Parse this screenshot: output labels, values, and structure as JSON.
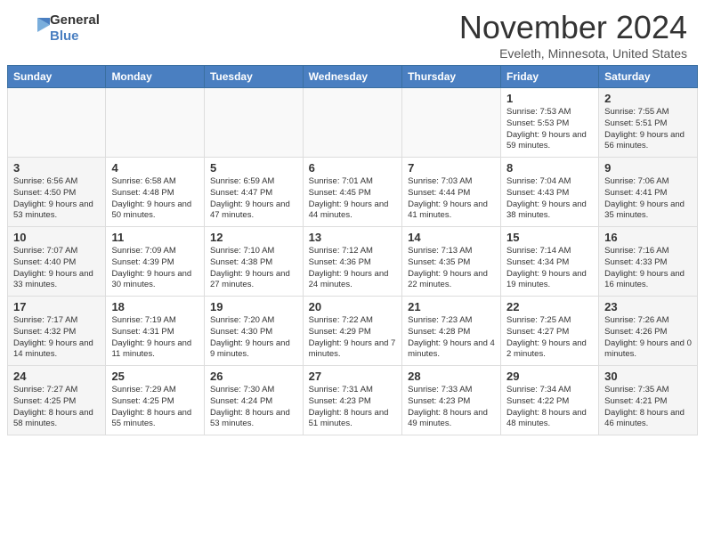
{
  "header": {
    "logo_general": "General",
    "logo_blue": "Blue",
    "month_title": "November 2024",
    "location": "Eveleth, Minnesota, United States"
  },
  "weekdays": [
    "Sunday",
    "Monday",
    "Tuesday",
    "Wednesday",
    "Thursday",
    "Friday",
    "Saturday"
  ],
  "weeks": [
    [
      {
        "day": "",
        "info": ""
      },
      {
        "day": "",
        "info": ""
      },
      {
        "day": "",
        "info": ""
      },
      {
        "day": "",
        "info": ""
      },
      {
        "day": "",
        "info": ""
      },
      {
        "day": "1",
        "info": "Sunrise: 7:53 AM\nSunset: 5:53 PM\nDaylight: 9 hours and 59 minutes."
      },
      {
        "day": "2",
        "info": "Sunrise: 7:55 AM\nSunset: 5:51 PM\nDaylight: 9 hours and 56 minutes."
      }
    ],
    [
      {
        "day": "3",
        "info": "Sunrise: 6:56 AM\nSunset: 4:50 PM\nDaylight: 9 hours and 53 minutes."
      },
      {
        "day": "4",
        "info": "Sunrise: 6:58 AM\nSunset: 4:48 PM\nDaylight: 9 hours and 50 minutes."
      },
      {
        "day": "5",
        "info": "Sunrise: 6:59 AM\nSunset: 4:47 PM\nDaylight: 9 hours and 47 minutes."
      },
      {
        "day": "6",
        "info": "Sunrise: 7:01 AM\nSunset: 4:45 PM\nDaylight: 9 hours and 44 minutes."
      },
      {
        "day": "7",
        "info": "Sunrise: 7:03 AM\nSunset: 4:44 PM\nDaylight: 9 hours and 41 minutes."
      },
      {
        "day": "8",
        "info": "Sunrise: 7:04 AM\nSunset: 4:43 PM\nDaylight: 9 hours and 38 minutes."
      },
      {
        "day": "9",
        "info": "Sunrise: 7:06 AM\nSunset: 4:41 PM\nDaylight: 9 hours and 35 minutes."
      }
    ],
    [
      {
        "day": "10",
        "info": "Sunrise: 7:07 AM\nSunset: 4:40 PM\nDaylight: 9 hours and 33 minutes."
      },
      {
        "day": "11",
        "info": "Sunrise: 7:09 AM\nSunset: 4:39 PM\nDaylight: 9 hours and 30 minutes."
      },
      {
        "day": "12",
        "info": "Sunrise: 7:10 AM\nSunset: 4:38 PM\nDaylight: 9 hours and 27 minutes."
      },
      {
        "day": "13",
        "info": "Sunrise: 7:12 AM\nSunset: 4:36 PM\nDaylight: 9 hours and 24 minutes."
      },
      {
        "day": "14",
        "info": "Sunrise: 7:13 AM\nSunset: 4:35 PM\nDaylight: 9 hours and 22 minutes."
      },
      {
        "day": "15",
        "info": "Sunrise: 7:14 AM\nSunset: 4:34 PM\nDaylight: 9 hours and 19 minutes."
      },
      {
        "day": "16",
        "info": "Sunrise: 7:16 AM\nSunset: 4:33 PM\nDaylight: 9 hours and 16 minutes."
      }
    ],
    [
      {
        "day": "17",
        "info": "Sunrise: 7:17 AM\nSunset: 4:32 PM\nDaylight: 9 hours and 14 minutes."
      },
      {
        "day": "18",
        "info": "Sunrise: 7:19 AM\nSunset: 4:31 PM\nDaylight: 9 hours and 11 minutes."
      },
      {
        "day": "19",
        "info": "Sunrise: 7:20 AM\nSunset: 4:30 PM\nDaylight: 9 hours and 9 minutes."
      },
      {
        "day": "20",
        "info": "Sunrise: 7:22 AM\nSunset: 4:29 PM\nDaylight: 9 hours and 7 minutes."
      },
      {
        "day": "21",
        "info": "Sunrise: 7:23 AM\nSunset: 4:28 PM\nDaylight: 9 hours and 4 minutes."
      },
      {
        "day": "22",
        "info": "Sunrise: 7:25 AM\nSunset: 4:27 PM\nDaylight: 9 hours and 2 minutes."
      },
      {
        "day": "23",
        "info": "Sunrise: 7:26 AM\nSunset: 4:26 PM\nDaylight: 9 hours and 0 minutes."
      }
    ],
    [
      {
        "day": "24",
        "info": "Sunrise: 7:27 AM\nSunset: 4:25 PM\nDaylight: 8 hours and 58 minutes."
      },
      {
        "day": "25",
        "info": "Sunrise: 7:29 AM\nSunset: 4:25 PM\nDaylight: 8 hours and 55 minutes."
      },
      {
        "day": "26",
        "info": "Sunrise: 7:30 AM\nSunset: 4:24 PM\nDaylight: 8 hours and 53 minutes."
      },
      {
        "day": "27",
        "info": "Sunrise: 7:31 AM\nSunset: 4:23 PM\nDaylight: 8 hours and 51 minutes."
      },
      {
        "day": "28",
        "info": "Sunrise: 7:33 AM\nSunset: 4:23 PM\nDaylight: 8 hours and 49 minutes."
      },
      {
        "day": "29",
        "info": "Sunrise: 7:34 AM\nSunset: 4:22 PM\nDaylight: 8 hours and 48 minutes."
      },
      {
        "day": "30",
        "info": "Sunrise: 7:35 AM\nSunset: 4:21 PM\nDaylight: 8 hours and 46 minutes."
      }
    ]
  ]
}
